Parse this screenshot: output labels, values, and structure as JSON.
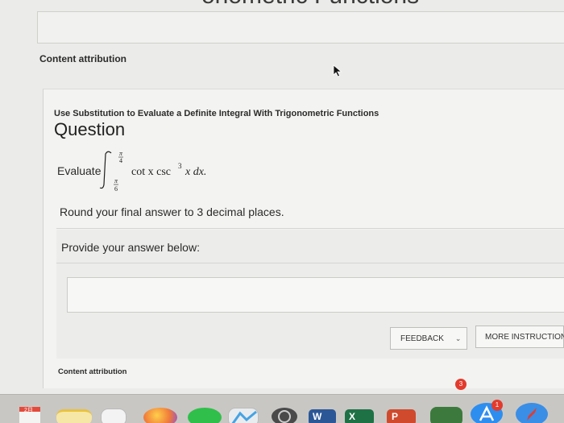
{
  "page": {
    "top_heading_fragment": "onometric Functions",
    "attribution_top": "Content attribution",
    "attribution_bottom": "Content attribution"
  },
  "question": {
    "subtitle": "Use Substitution to Evaluate a Definite Integral With Trigonometric Functions",
    "title": "Question",
    "evaluate_label": "Evaluate",
    "integral": {
      "upper_limit_num": "π",
      "upper_limit_den": "4",
      "lower_limit_num": "π",
      "lower_limit_den": "6",
      "integrand": "cot x csc",
      "exponent": "3",
      "tail": "x dx."
    },
    "instruction": "Round your final answer to 3 decimal places."
  },
  "answer": {
    "prompt": "Provide your answer below:",
    "input_value": ""
  },
  "buttons": {
    "feedback": "FEEDBACK",
    "more_instruction": "MORE INSTRUCTION"
  },
  "dock": {
    "calendar_day": "2月",
    "badge_appstore": "3",
    "badge_other": "1",
    "word_letter": "W",
    "excel_letter": "X",
    "ppt_letter": "P"
  },
  "colors": {
    "background": "#ebebe9",
    "card": "#f3f3f1",
    "dock": "#c9c7c4",
    "badge": "#e23b2d"
  }
}
